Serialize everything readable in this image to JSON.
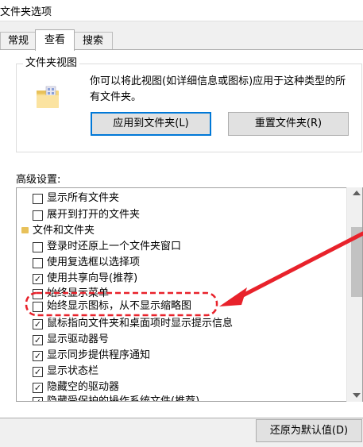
{
  "window": {
    "title": "文件夹选项"
  },
  "tabs": [
    {
      "label": "常规"
    },
    {
      "label": "查看"
    },
    {
      "label": "搜索"
    }
  ],
  "folder_views": {
    "legend": "文件夹视图",
    "description": "你可以将此视图(如详细信息或图标)应用于这种类型的所有文件夹。",
    "apply_button": "应用到文件夹(L)",
    "reset_button": "重置文件夹(R)"
  },
  "advanced": {
    "label": "高级设置:",
    "items": [
      {
        "text": "显示所有文件夹",
        "checked": false,
        "kind": "checkbox"
      },
      {
        "text": "展开到打开的文件夹",
        "checked": false,
        "kind": "checkbox"
      },
      {
        "text": "文件和文件夹",
        "kind": "folder"
      },
      {
        "text": "登录时还原上一个文件夹窗口",
        "checked": false,
        "kind": "checkbox"
      },
      {
        "text": "使用复选框以选择项",
        "checked": false,
        "kind": "checkbox"
      },
      {
        "text": "使用共享向导(推荐)",
        "checked": true,
        "kind": "checkbox"
      },
      {
        "text": "始终显示菜单",
        "checked": false,
        "kind": "checkbox"
      },
      {
        "text": "始终显示图标，从不显示缩略图",
        "checked": false,
        "kind": "checkbox"
      },
      {
        "text": "鼠标指向文件夹和桌面项时显示提示信息",
        "checked": true,
        "kind": "checkbox"
      },
      {
        "text": "显示驱动器号",
        "checked": true,
        "kind": "checkbox"
      },
      {
        "text": "显示同步提供程序通知",
        "checked": true,
        "kind": "checkbox"
      },
      {
        "text": "显示状态栏",
        "checked": true,
        "kind": "checkbox"
      },
      {
        "text": "隐藏空的驱动器",
        "checked": true,
        "kind": "checkbox"
      },
      {
        "text": "隐藏受保护的操作系统文件(推荐)",
        "checked": true,
        "kind": "checkbox"
      }
    ],
    "restore_button": "还原为默认值(D)"
  },
  "colors": {
    "annotation_red": "#e8222b",
    "accent_blue": "#0078d7"
  }
}
